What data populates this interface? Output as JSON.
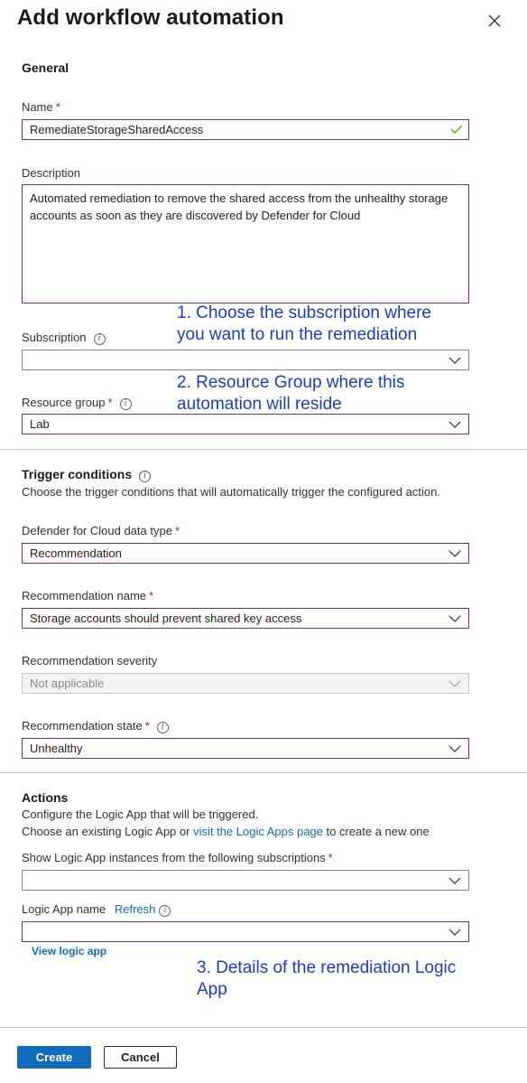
{
  "panel": {
    "title": "Add workflow automation"
  },
  "general": {
    "heading": "General",
    "name_label": "Name",
    "name_value": "RemediateStorageSharedAccess",
    "description_label": "Description",
    "description_value": "Automated remediation to remove the shared access from the unhealthy storage accounts as soon as they are discovered by Defender for Cloud",
    "subscription_label": "Subscription",
    "subscription_value": "",
    "resource_group_label": "Resource group",
    "resource_group_value": "Lab"
  },
  "trigger": {
    "heading": "Trigger conditions",
    "description": "Choose the trigger conditions that will automatically trigger the configured action.",
    "data_type_label": "Defender for Cloud data type",
    "data_type_value": "Recommendation",
    "rec_name_label": "Recommendation name",
    "rec_name_value": "Storage accounts should prevent shared key access",
    "severity_label": "Recommendation severity",
    "severity_value": "Not applicable",
    "state_label": "Recommendation state",
    "state_value": "Unhealthy"
  },
  "actions": {
    "heading": "Actions",
    "line1": "Configure the Logic App that will be triggered.",
    "line2_prefix": "Choose an existing Logic App or ",
    "line2_link": "visit the Logic Apps page",
    "line2_suffix": " to create a new one",
    "instances_label": "Show Logic App instances from the following subscriptions",
    "instances_value": "",
    "logic_app_label": "Logic App name",
    "refresh_label": "Refresh",
    "logic_app_value": "",
    "view_link": "View logic app"
  },
  "annotations": {
    "a1_line1": "1. Choose the subscription where",
    "a1_line2": "you want to run the remediation",
    "a2_line1": "2. Resource Group where this",
    "a2_line2": "automation will reside",
    "a3_line1": "3. Details of the remediation Logic",
    "a3_line2": "App"
  },
  "footer": {
    "create_label": "Create",
    "cancel_label": "Cancel"
  },
  "colors": {
    "field_border": "#7b2d7b",
    "annotation": "#1a3cc8",
    "primary": "#0f6cbd",
    "required": "#a4262c",
    "valid_check": "#57a300"
  },
  "icons": {
    "close": "close-icon",
    "chevron": "chevron-down-icon",
    "info": "info-icon",
    "check": "checkmark-icon"
  }
}
